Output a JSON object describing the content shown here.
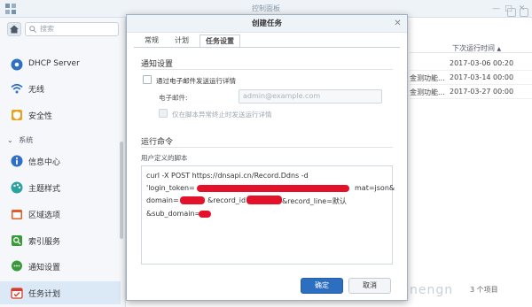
{
  "window": {
    "title": "控制面板",
    "minimize": "—",
    "maximize": "□",
    "close": "✕"
  },
  "search": {
    "placeholder": "搜索"
  },
  "sidebar": {
    "items": [
      {
        "label": "DHCP Server",
        "icon": "dhcp-icon",
        "color": "#2f6fc4"
      },
      {
        "label": "无线",
        "icon": "wifi-icon",
        "color": "#2f6fc4"
      },
      {
        "label": "安全性",
        "icon": "shield-icon",
        "color": "#e8a21c"
      },
      {
        "label": "信息中心",
        "icon": "info-icon",
        "color": "#2f6fc4"
      },
      {
        "label": "主题样式",
        "icon": "palette-icon",
        "color": "#2aa3a0"
      },
      {
        "label": "区域选项",
        "icon": "calendar-icon",
        "color": "#e25c2a"
      },
      {
        "label": "索引服务",
        "icon": "index-icon",
        "color": "#3a9a3a"
      },
      {
        "label": "通知设置",
        "icon": "chat-icon",
        "color": "#3a9a3a"
      },
      {
        "label": "任务计划",
        "icon": "task-icon",
        "color": "#d93a2b"
      }
    ],
    "section_system": "系统"
  },
  "table": {
    "header_next_run": "下次运行时间",
    "sort_indicator": "▲",
    "rows": [
      {
        "c1": "",
        "c2": "2017-03-06 00:20"
      },
      {
        "c1": "金测功能...",
        "c2": "2017-03-14 00:00"
      },
      {
        "c1": "金测功能...",
        "c2": "2017-03-27 00:00"
      }
    ],
    "item_count": "3 个项目"
  },
  "watermark": "nengn",
  "dialog": {
    "title": "创建任务",
    "tabs": [
      {
        "label": "常规"
      },
      {
        "label": "计划"
      },
      {
        "label": "任务设置",
        "active": true
      }
    ],
    "notify_section": "通知设置",
    "email_checkbox_label": "通过电子邮件发送运行详情",
    "email_label": "电子邮件:",
    "email_placeholder": "admin@example.com",
    "abnormal_checkbox_label": "仅在脚本异常终止时发送运行详情",
    "command_section": "运行命令",
    "script_label": "用户定义的脚本",
    "script_lines": [
      "curl -X POST https://dnsapi.cn/Record.Ddns -d",
      "'login_token=",
      "mat=json&",
      "domain=",
      "&record_id=",
      "&record_line=默认",
      "&sub_domain="
    ],
    "ok_button": "确定",
    "cancel_button": "取消"
  },
  "colors": {
    "accent": "#2c6fc0",
    "redaction": "#e3122a"
  }
}
